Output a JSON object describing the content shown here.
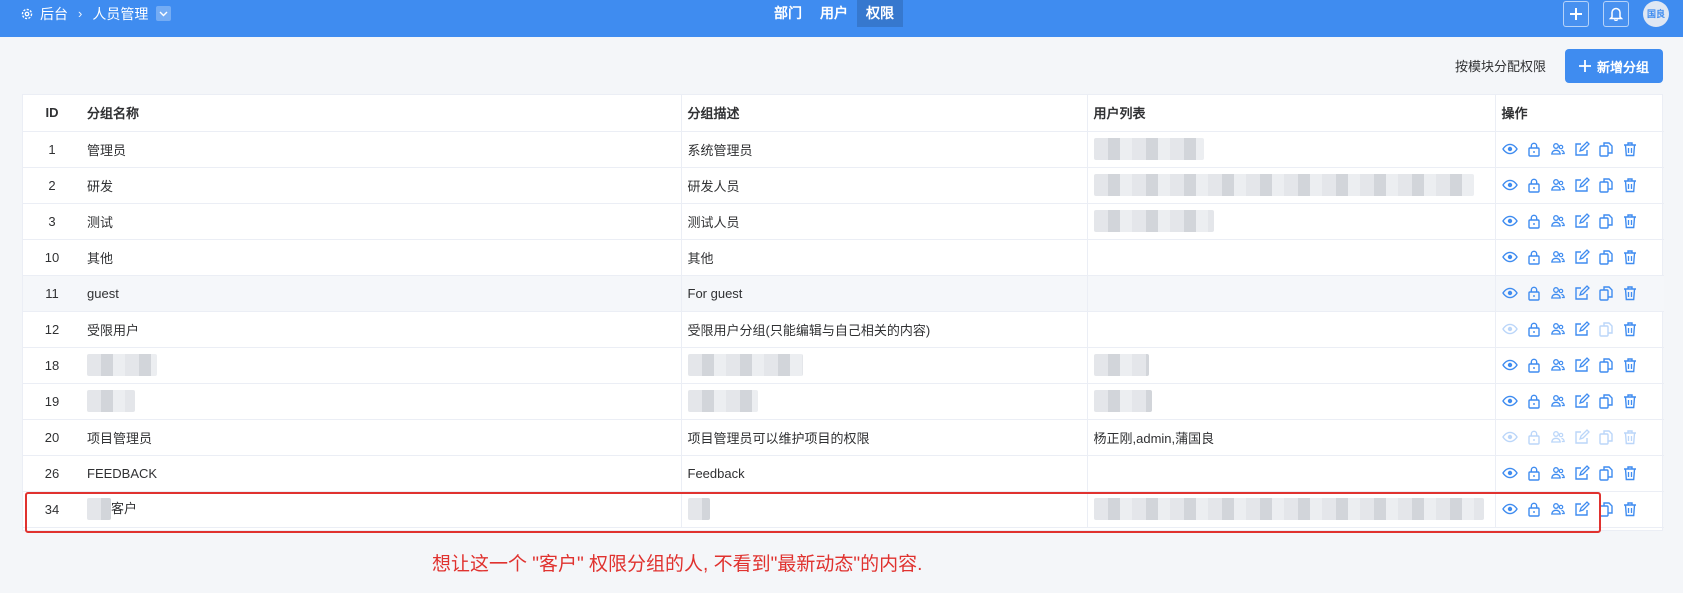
{
  "topbar": {
    "breadcrumb_root": "后台",
    "breadcrumb_current": "人员管理",
    "tabs": [
      "部门",
      "用户",
      "权限"
    ],
    "active_tab": "权限",
    "avatar_text": "国良",
    "accent": "#3f8cf0"
  },
  "toolbar": {
    "assign_by_module": "按模块分配权限",
    "add_group": "新增分组"
  },
  "table": {
    "headers": {
      "id": "ID",
      "name": "分组名称",
      "desc": "分组描述",
      "users": "用户列表",
      "ops": "操作"
    },
    "rows": [
      {
        "id": "1",
        "name": "管理员",
        "desc": "系统管理员",
        "users": ""
      },
      {
        "id": "2",
        "name": "研发",
        "desc": "研发人员",
        "users": ""
      },
      {
        "id": "3",
        "name": "测试",
        "desc": "测试人员",
        "users": ""
      },
      {
        "id": "10",
        "name": "其他",
        "desc": "其他",
        "users": ""
      },
      {
        "id": "11",
        "name": "guest",
        "desc": "For guest",
        "users": ""
      },
      {
        "id": "12",
        "name": "受限用户",
        "desc": "受限用户分组(只能编辑与自己相关的内容)",
        "users": ""
      },
      {
        "id": "18",
        "name": "",
        "desc": "",
        "users": ""
      },
      {
        "id": "19",
        "name": "",
        "desc": "",
        "users": ""
      },
      {
        "id": "20",
        "name": "项目管理员",
        "desc": "项目管理员可以维护项目的权限",
        "users": "杨正刚,admin,蒲国良"
      },
      {
        "id": "26",
        "name": "FEEDBACK",
        "desc": "Feedback",
        "users": ""
      },
      {
        "id": "34",
        "name": "客户",
        "desc": "",
        "users": ""
      }
    ]
  },
  "annotation": {
    "note": "想让这一个 \"客户\" 权限分组的人, 不看到\"最新动态\"的内容.",
    "color": "#e0322f"
  }
}
